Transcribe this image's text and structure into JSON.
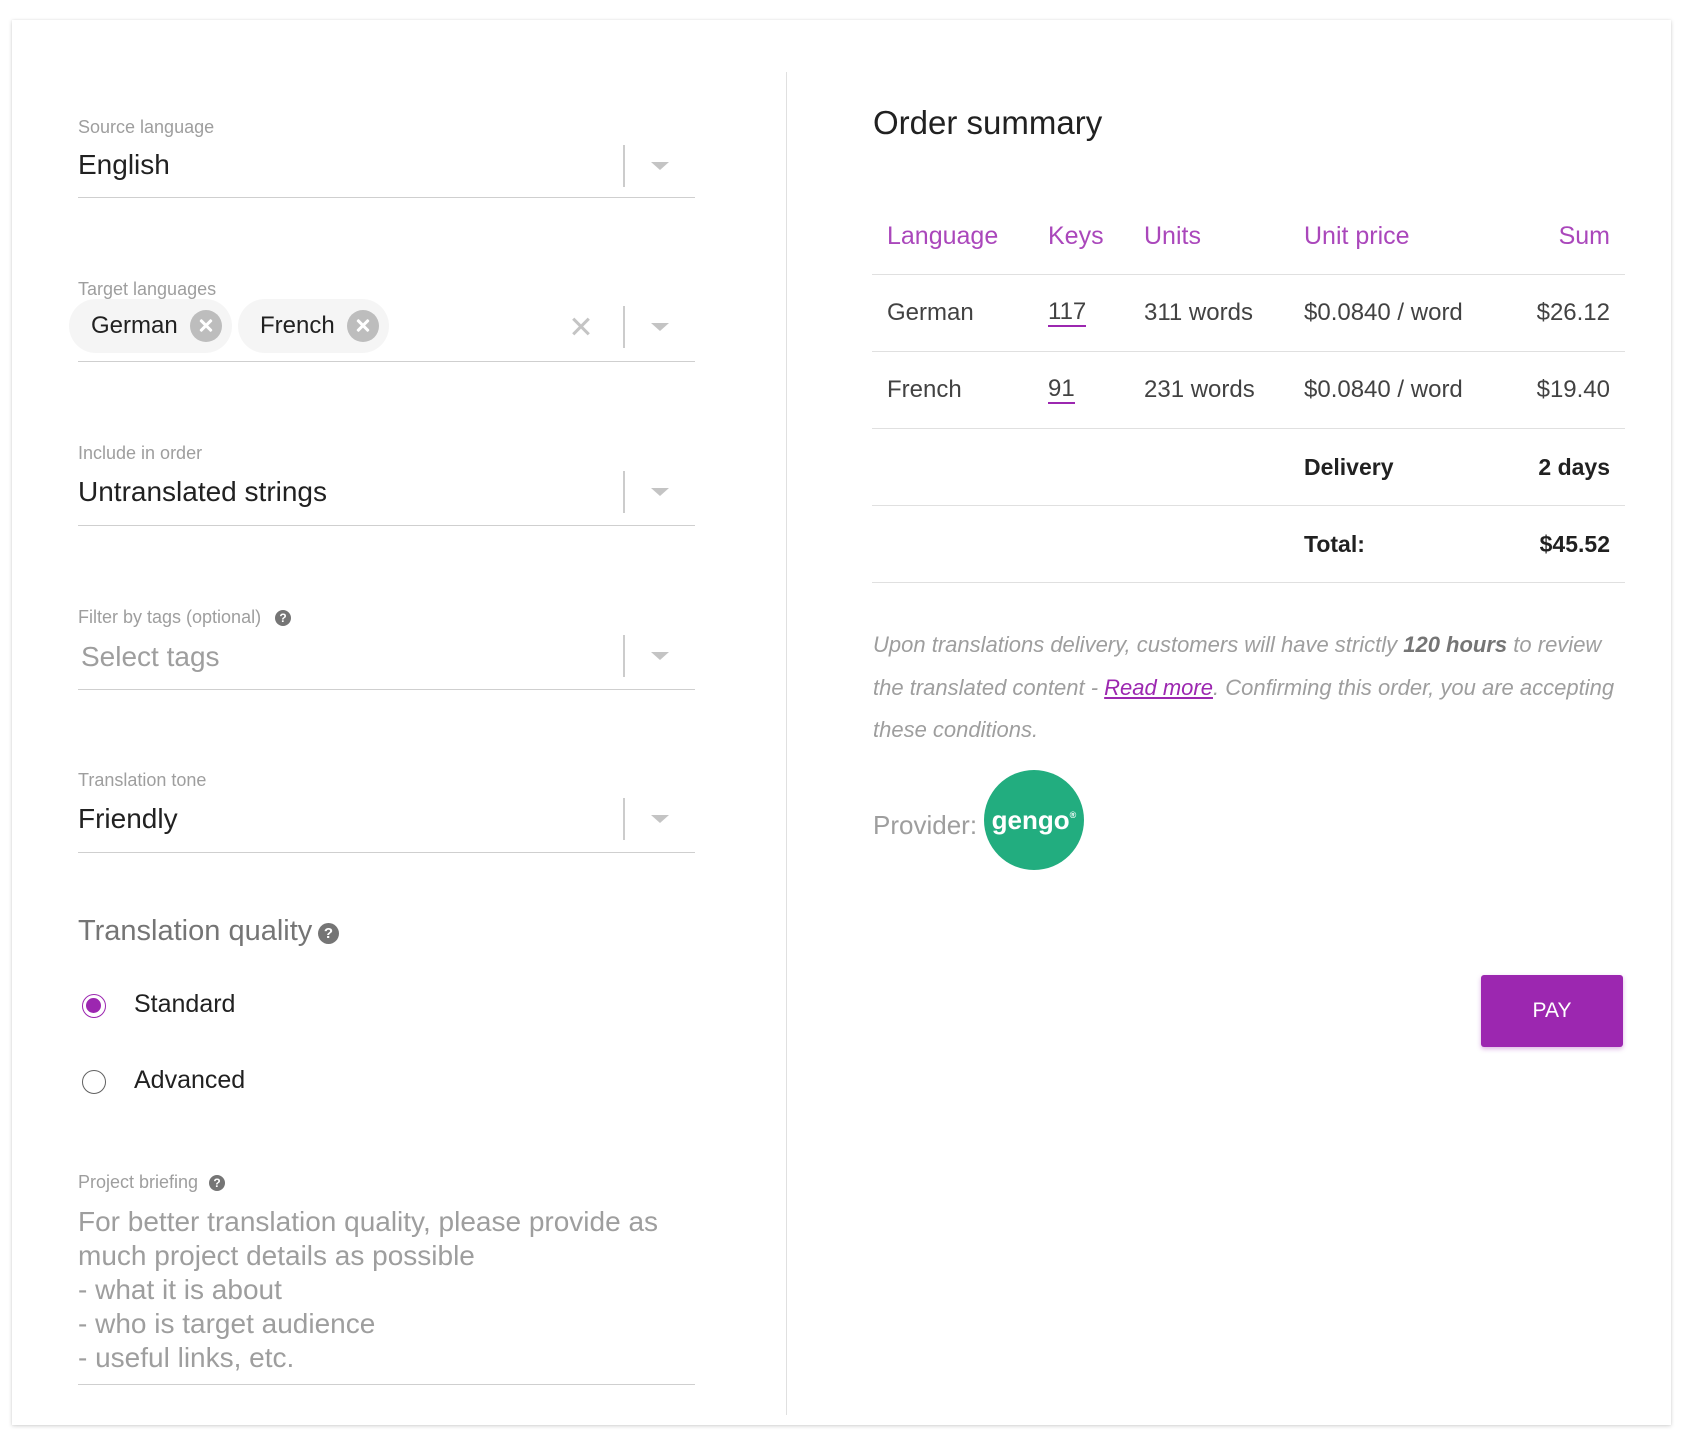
{
  "form": {
    "source_language": {
      "label": "Source language",
      "value": "English"
    },
    "target_languages": {
      "label": "Target languages",
      "chips": [
        "German",
        "French"
      ]
    },
    "include_in_order": {
      "label": "Include in order",
      "value": "Untranslated strings"
    },
    "filter_by_tags": {
      "label": "Filter by tags (optional)",
      "placeholder": "Select tags"
    },
    "translation_tone": {
      "label": "Translation tone",
      "value": "Friendly"
    },
    "translation_quality": {
      "title": "Translation quality",
      "options": [
        {
          "label": "Standard",
          "checked": true
        },
        {
          "label": "Advanced",
          "checked": false
        }
      ]
    },
    "project_briefing": {
      "label": "Project briefing",
      "placeholder": "For better translation quality, please provide as much project details as possible\n - what it is about\n - who is target audience\n - useful links, etc."
    },
    "help_icon_glyph": "?"
  },
  "summary": {
    "title": "Order summary",
    "columns": [
      "Language",
      "Keys",
      "Units",
      "Unit price",
      "Sum"
    ],
    "rows": [
      {
        "language": "German",
        "keys": "117",
        "units": "311 words",
        "unit_price": "$0.0840 / word",
        "sum": "$26.12"
      },
      {
        "language": "French",
        "keys": "91",
        "units": "231 words",
        "unit_price": "$0.0840 / word",
        "sum": "$19.40"
      }
    ],
    "delivery": {
      "label": "Delivery",
      "value": "2 days"
    },
    "total": {
      "label": "Total:",
      "value": "$45.52"
    },
    "notice": {
      "part1": "Upon translations delivery, customers will have strictly ",
      "bold": "120 hours",
      "part2": " to review the translated content - ",
      "link": "Read more",
      "part3": ". Confirming this order, you are accepting these conditions."
    },
    "provider": {
      "label": "Provider:",
      "name": "gengo"
    },
    "pay_label": "PAY"
  },
  "colors": {
    "accent": "#9c27b0",
    "provider_green": "#22ad7f"
  }
}
